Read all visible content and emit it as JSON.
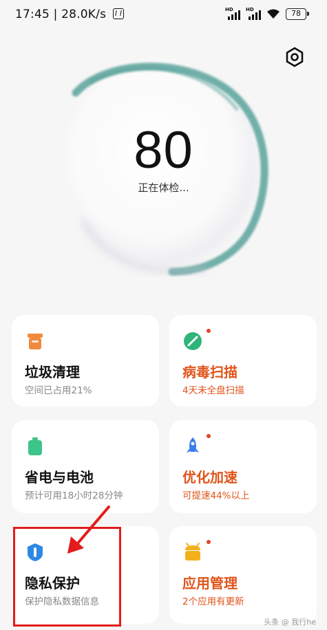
{
  "status_bar": {
    "time": "17:45",
    "net_speed": "28.0K/s",
    "signal_labels": [
      "HD",
      "HD"
    ],
    "battery": "78"
  },
  "hero": {
    "score": "80",
    "status": "正在体检..."
  },
  "tiles": [
    {
      "title": "垃圾清理",
      "subtitle": "空间已占用21%",
      "icon": "trash-icon",
      "warning": false
    },
    {
      "title": "病毒扫描",
      "subtitle": "4天未全盘扫描",
      "icon": "shield-scan-icon",
      "warning": true
    },
    {
      "title": "省电与电池",
      "subtitle": "预计可用18小时28分钟",
      "icon": "battery-icon",
      "warning": false
    },
    {
      "title": "优化加速",
      "subtitle": "可提速44%以上",
      "icon": "rocket-icon",
      "warning": true
    },
    {
      "title": "隐私保护",
      "subtitle": "保护隐私数据信息",
      "icon": "privacy-shield-icon",
      "warning": false
    },
    {
      "title": "应用管理",
      "subtitle": "2个应用有更新",
      "icon": "app-manager-icon",
      "warning": true
    }
  ],
  "watermark": "头条 @ 我行he",
  "colors": {
    "warning": "#e0541b",
    "highlight": "#e31b1b",
    "ring": "#5aa39b"
  }
}
